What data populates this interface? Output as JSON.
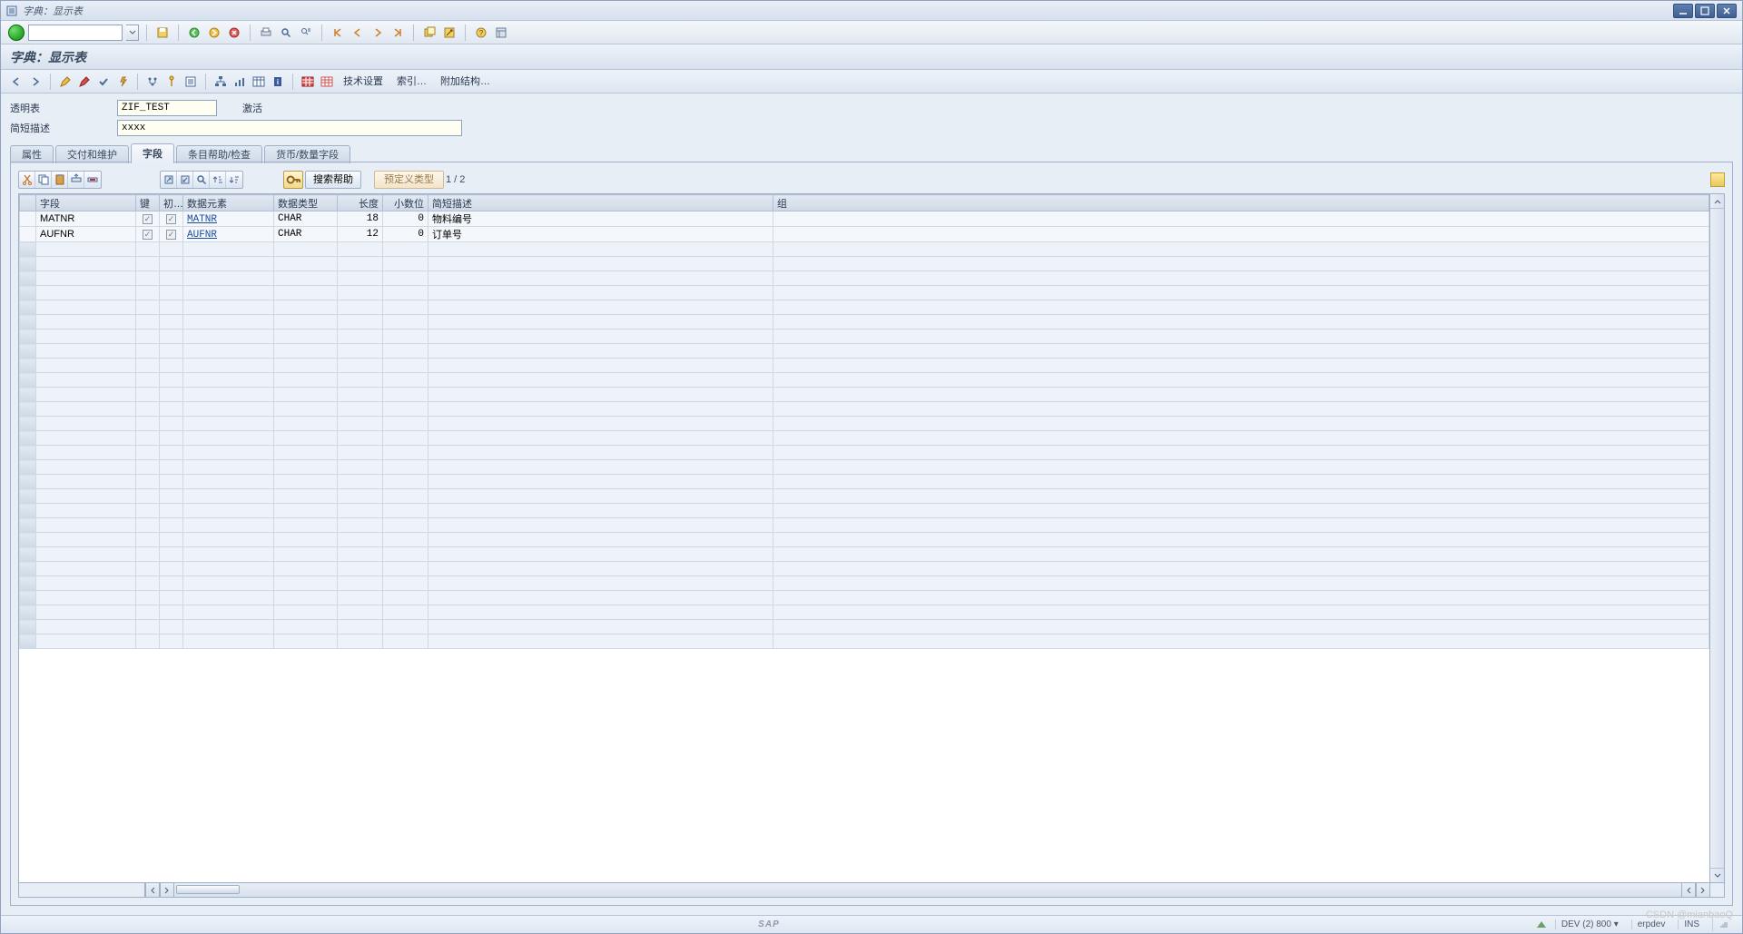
{
  "window": {
    "title": "字典：显示表"
  },
  "page": {
    "title": "字典：显示表"
  },
  "apptoolbar": {
    "tech_settings": "技术设置",
    "indexes": "索引…",
    "append": "附加结构…"
  },
  "form": {
    "table_label": "透明表",
    "table_value": "ZIF_TEST",
    "status": "激活",
    "desc_label": "简短描述",
    "desc_value": "xxxx"
  },
  "tabs": {
    "attr": "属性",
    "delivery": "交付和维护",
    "fields": "字段",
    "entryhelp": "条目帮助/检查",
    "currency": "货币/数量字段"
  },
  "tabletoolbar": {
    "searchhelp": "搜索帮助",
    "predef": "预定义类型",
    "pager": "1 / 2"
  },
  "columns": {
    "field": "字段",
    "key": "键",
    "init": "初…",
    "dataelem": "数据元素",
    "datatype": "数据类型",
    "length": "长度",
    "decimals": "小数位",
    "shortdesc": "简短描述",
    "group": "组"
  },
  "rows": [
    {
      "field": "MATNR",
      "key": true,
      "init": true,
      "dataelem": "MATNR",
      "datatype": "CHAR",
      "length": "18",
      "decimals": "0",
      "shortdesc": "物料编号",
      "group": ""
    },
    {
      "field": "AUFNR",
      "key": true,
      "init": true,
      "dataelem": "AUFNR",
      "datatype": "CHAR",
      "length": "12",
      "decimals": "0",
      "shortdesc": "订单号",
      "group": ""
    }
  ],
  "statusbar": {
    "sap": "SAP",
    "system": "DEV (2) 800",
    "host": "erpdev",
    "mode": "INS"
  },
  "watermark": "CSDN @mianbaoQ"
}
